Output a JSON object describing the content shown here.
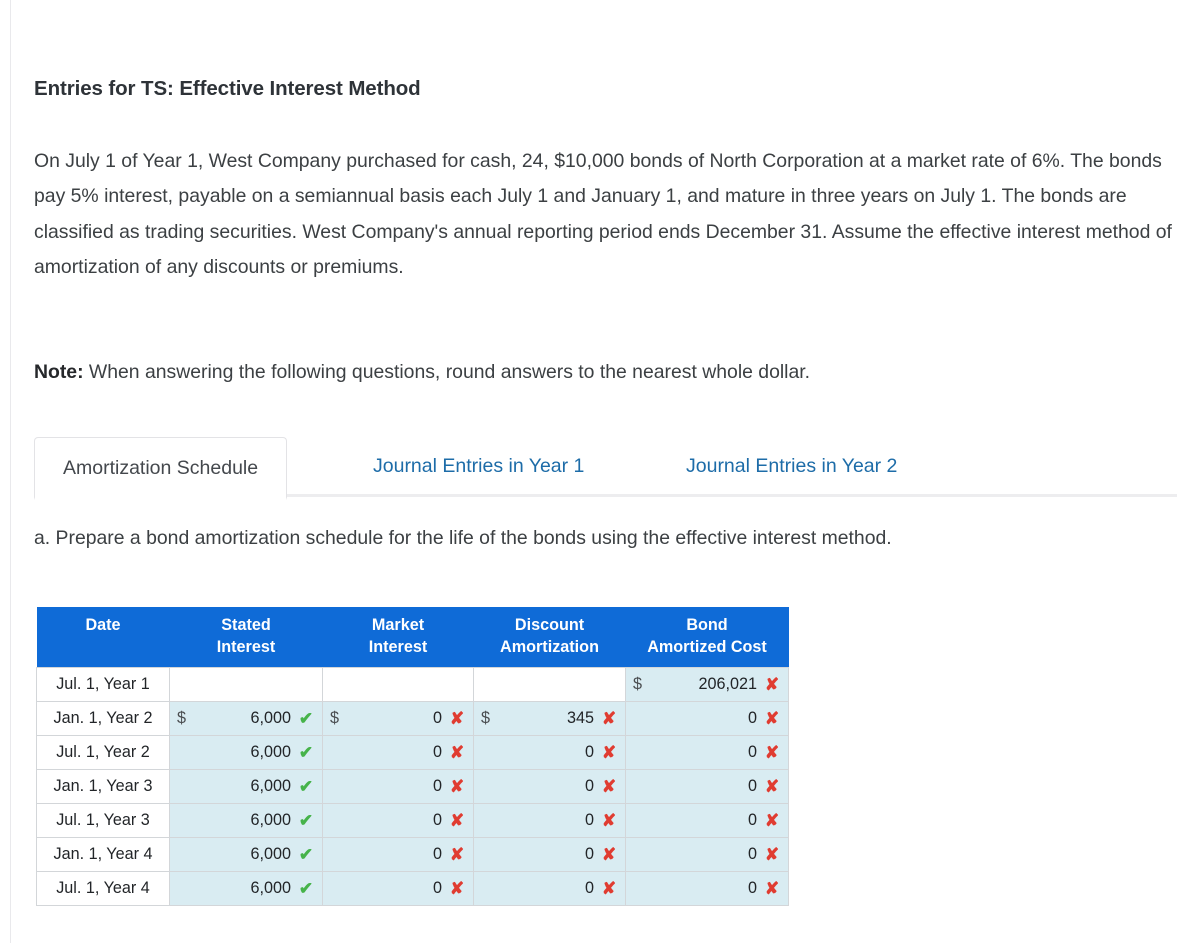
{
  "title": "Entries for TS: Effective Interest Method",
  "paragraph": "On July 1 of Year 1, West Company purchased for cash, 24, $10,000 bonds of North Corporation at a market rate of 6%. The bonds pay 5% interest, payable on a semiannual basis each July 1 and January 1, and mature in three years on July 1. The bonds are classified as trading securities. West Company's annual reporting period ends December 31. Assume the effective interest method of amortization of any discounts or premiums.",
  "note": {
    "label": "Note:",
    "text": " When answering the following questions, round answers to the nearest whole dollar."
  },
  "tabs": [
    {
      "label": "Amortization Schedule",
      "active": true
    },
    {
      "label": "Journal Entries in Year 1",
      "active": false
    },
    {
      "label": "Journal Entries in Year 2",
      "active": false
    }
  ],
  "prompt": "a. Prepare a bond amortization schedule for the life of the bonds using the effective interest method.",
  "colors": {
    "table_header_blue": "#0f6bd7",
    "input_cell_blue": "#d9ecf2",
    "correct_green": "#46b34a",
    "incorrect_red": "#e03c31",
    "tab_link_blue": "#1d6ca8"
  },
  "table": {
    "headers": [
      {
        "line1": "Date",
        "line2": ""
      },
      {
        "line1": "Stated",
        "line2": "Interest"
      },
      {
        "line1": "Market",
        "line2": "Interest"
      },
      {
        "line1": "Discount",
        "line2": "Amortization"
      },
      {
        "line1": "Bond",
        "line2": "Amortized Cost"
      }
    ],
    "rows": [
      {
        "date": "Jul. 1, Year 1",
        "stated": {
          "currency": "",
          "value": "",
          "mark": "none"
        },
        "market": {
          "currency": "",
          "value": "",
          "mark": "none"
        },
        "discount": {
          "currency": "",
          "value": "",
          "mark": "none"
        },
        "bond": {
          "currency": "$",
          "value": "206,021",
          "mark": "no"
        },
        "blank_cells": true
      },
      {
        "date": "Jan. 1, Year 2",
        "stated": {
          "currency": "$",
          "value": "6,000",
          "mark": "ok"
        },
        "market": {
          "currency": "$",
          "value": "0",
          "mark": "no"
        },
        "discount": {
          "currency": "$",
          "value": "345",
          "mark": "no"
        },
        "bond": {
          "currency": "",
          "value": "0",
          "mark": "no"
        },
        "blank_cells": false
      },
      {
        "date": "Jul. 1, Year 2",
        "stated": {
          "currency": "",
          "value": "6,000",
          "mark": "ok"
        },
        "market": {
          "currency": "",
          "value": "0",
          "mark": "no"
        },
        "discount": {
          "currency": "",
          "value": "0",
          "mark": "no"
        },
        "bond": {
          "currency": "",
          "value": "0",
          "mark": "no"
        },
        "blank_cells": false
      },
      {
        "date": "Jan. 1, Year 3",
        "stated": {
          "currency": "",
          "value": "6,000",
          "mark": "ok"
        },
        "market": {
          "currency": "",
          "value": "0",
          "mark": "no"
        },
        "discount": {
          "currency": "",
          "value": "0",
          "mark": "no"
        },
        "bond": {
          "currency": "",
          "value": "0",
          "mark": "no"
        },
        "blank_cells": false
      },
      {
        "date": "Jul. 1, Year 3",
        "stated": {
          "currency": "",
          "value": "6,000",
          "mark": "ok"
        },
        "market": {
          "currency": "",
          "value": "0",
          "mark": "no"
        },
        "discount": {
          "currency": "",
          "value": "0",
          "mark": "no"
        },
        "bond": {
          "currency": "",
          "value": "0",
          "mark": "no"
        },
        "blank_cells": false
      },
      {
        "date": "Jan. 1, Year 4",
        "stated": {
          "currency": "",
          "value": "6,000",
          "mark": "ok"
        },
        "market": {
          "currency": "",
          "value": "0",
          "mark": "no"
        },
        "discount": {
          "currency": "",
          "value": "0",
          "mark": "no"
        },
        "bond": {
          "currency": "",
          "value": "0",
          "mark": "no"
        },
        "blank_cells": false
      },
      {
        "date": "Jul. 1, Year 4",
        "stated": {
          "currency": "",
          "value": "6,000",
          "mark": "ok"
        },
        "market": {
          "currency": "",
          "value": "0",
          "mark": "no"
        },
        "discount": {
          "currency": "",
          "value": "0",
          "mark": "no"
        },
        "bond": {
          "currency": "",
          "value": "0",
          "mark": "no"
        },
        "blank_cells": false
      }
    ],
    "mark_glyphs": {
      "ok": "✔",
      "no": "✘",
      "none": ""
    }
  }
}
